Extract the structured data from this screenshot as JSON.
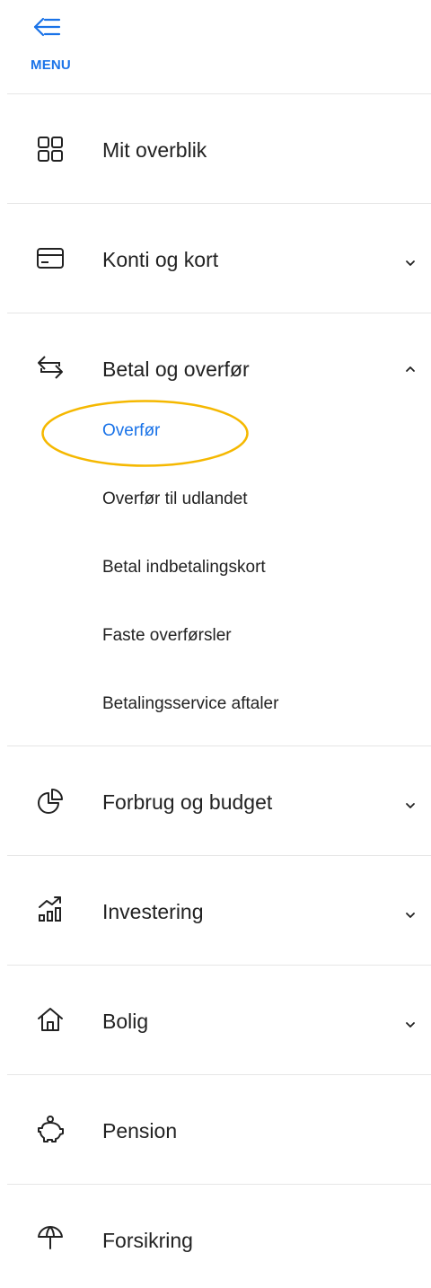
{
  "menu": {
    "label": "MENU"
  },
  "nav": {
    "items": [
      {
        "label": "Mit overblik",
        "icon": "dashboard-grid-icon"
      },
      {
        "label": "Konti og kort",
        "icon": "credit-card-icon",
        "chevron": "chevron-down-icon"
      },
      {
        "label": "Betal og overfør",
        "icon": "transfer-arrows-icon",
        "chevron": "chevron-up-icon",
        "expanded": true
      },
      {
        "label": "Forbrug og budget",
        "icon": "pie-chart-icon",
        "chevron": "chevron-down-icon"
      },
      {
        "label": "Investering",
        "icon": "investment-chart-icon",
        "chevron": "chevron-down-icon"
      },
      {
        "label": "Bolig",
        "icon": "home-icon",
        "chevron": "chevron-down-icon"
      },
      {
        "label": "Pension",
        "icon": "piggy-bank-icon"
      },
      {
        "label": "Forsikring",
        "icon": "umbrella-icon"
      }
    ],
    "betal_sub": [
      {
        "label": "Overfør",
        "active": true
      },
      {
        "label": "Overfør til udlandet"
      },
      {
        "label": "Betal indbetalingskort"
      },
      {
        "label": "Faste overførsler"
      },
      {
        "label": "Betalingsservice aftaler"
      }
    ]
  },
  "colors": {
    "accent": "#1a73e8",
    "highlight": "#f5b800",
    "divider": "#e6e6e6",
    "text": "#222222"
  }
}
